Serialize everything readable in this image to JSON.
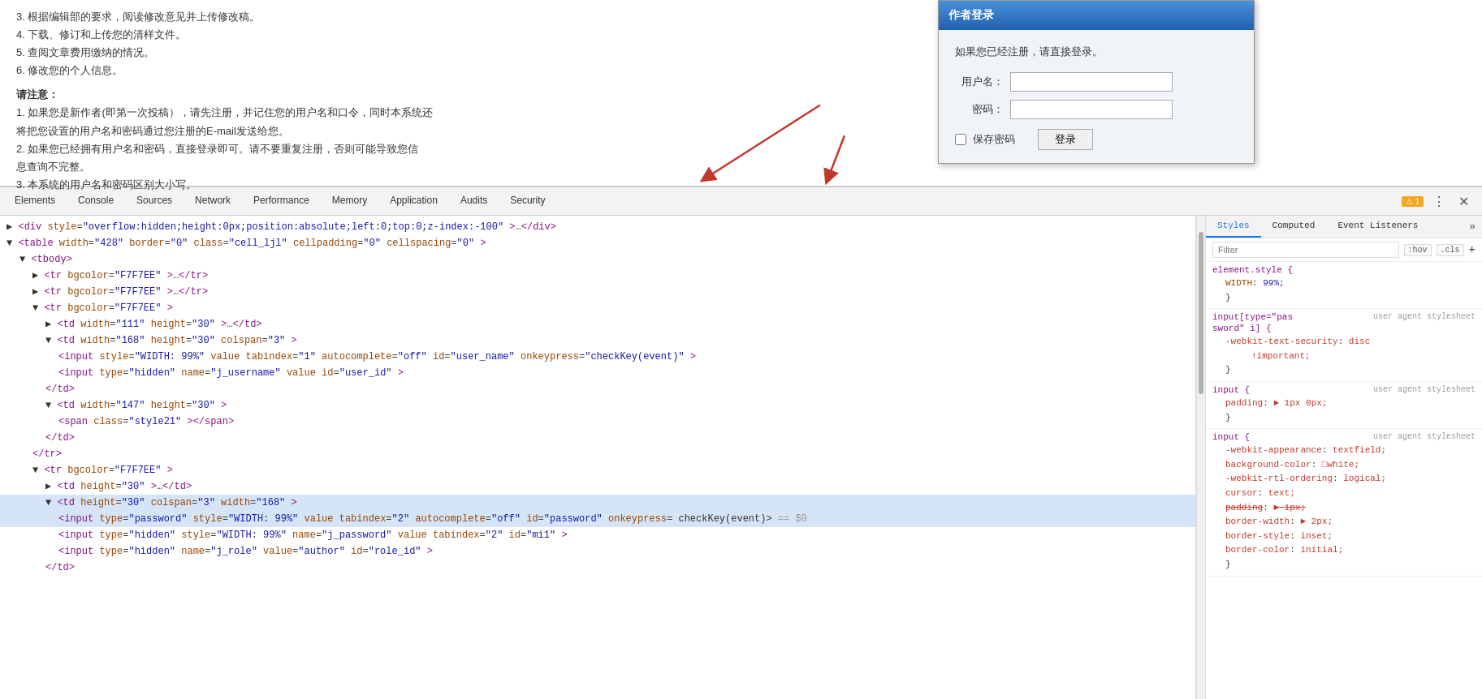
{
  "page": {
    "content_lines": [
      "3. 根据编辑部的要求，阅读修改意见并上传修改稿。",
      "4. 下载、修订和上传您的清样文件。",
      "5. 查阅文章费用缴纳的情况。",
      "6. 修改您的个人信息。",
      "",
      "请注意：",
      "1. 如果您是新作者(即第一次投稿），请先注册，并记住您的用户名和口令，同时本系统还将把您设置的用户名和密码通过您注册的E-mail发送给您。",
      "2. 如果您已经拥有用户名和密码，直接登录即可。请不要重复注册，否则可能导致您信息查询不完整。",
      "3. 本系统的用户名和密码区别大小写。"
    ]
  },
  "dialog": {
    "title": "作者登录",
    "hint": "如果您已经注册，请直接登录。",
    "username_label": "用户名：",
    "password_label": "密码：",
    "save_password_label": "保存密码",
    "login_button": "登录"
  },
  "devtools": {
    "tabs": [
      {
        "id": "elements",
        "label": "Elements",
        "active": false
      },
      {
        "id": "console",
        "label": "Console",
        "active": false
      },
      {
        "id": "sources",
        "label": "Sources",
        "active": false
      },
      {
        "id": "network",
        "label": "Network",
        "active": false
      },
      {
        "id": "performance",
        "label": "Performance",
        "active": false
      },
      {
        "id": "memory",
        "label": "Memory",
        "active": false
      },
      {
        "id": "application",
        "label": "Application",
        "active": false
      },
      {
        "id": "audits",
        "label": "Audits",
        "active": false
      },
      {
        "id": "security",
        "label": "Security",
        "active": false
      }
    ],
    "warning_count": "1",
    "styles_panel": {
      "tabs": [
        "Styles",
        "Computed",
        "Event Listeners"
      ],
      "filter_placeholder": "Filter",
      "filter_pseudo": ":hov",
      "filter_class": ".cls",
      "rules": [
        {
          "selector": "element.style {",
          "source": "",
          "properties": [
            {
              "name": "WIDTH",
              "colon": ":",
              "value": "99%;",
              "strikethrough": false
            }
          ]
        },
        {
          "selector": "input[type=\"pas user agent stylesheet",
          "selector2": "sword\" i] {",
          "source": "",
          "properties": [
            {
              "name": "-webkit-text-security",
              "colon": ":",
              "value": "disc",
              "extra": "!important;",
              "strikethrough": false,
              "red": true
            }
          ]
        },
        {
          "selector": "input {",
          "source": "user agent stylesheet",
          "properties": [
            {
              "name": "padding",
              "colon": ":",
              "value": "► 1px 0px;",
              "strikethrough": false,
              "red": true
            }
          ]
        },
        {
          "selector": "input {",
          "source": "user agent stylesheet",
          "properties": [
            {
              "name": "-webkit-appearance",
              "colon": ":",
              "value": "textfield;",
              "red": true
            },
            {
              "name": "background-color",
              "colon": ":",
              "value": "□white;",
              "red": true
            },
            {
              "name": "-webkit-rtl-ordering",
              "colon": ":",
              "value": "logical;",
              "red": true
            },
            {
              "name": "cursor",
              "colon": ":",
              "value": "text;",
              "red": true
            },
            {
              "name": "padding",
              "colon": ":",
              "value": "► 1px;",
              "strikethrough": true,
              "red": true
            },
            {
              "name": "border-width",
              "colon": ":",
              "value": "► 2px;",
              "red": true
            },
            {
              "name": "border-style",
              "colon": ":",
              "value": "inset;",
              "red": true
            },
            {
              "name": "border-color",
              "colon": ":",
              "value": "initial;",
              "red": true
            }
          ]
        }
      ]
    }
  },
  "dom": {
    "lines": [
      {
        "indent": 0,
        "toggle": "▶",
        "html": "&lt;div style=\"overflow:hidden;height:0px;position:absolute;left:0;top:0;z-index:-100\"&gt;…&lt;/div&gt;",
        "id": "l1"
      },
      {
        "indent": 0,
        "toggle": "▼",
        "html": "&lt;table width=\"428\" border=\"0\" class=\"cell_ljl\" cellpadding=\"0\" cellspacing=\"0\"&gt;",
        "id": "l2"
      },
      {
        "indent": 1,
        "toggle": "▼",
        "html": "&lt;tbody&gt;",
        "id": "l3"
      },
      {
        "indent": 2,
        "toggle": "▶",
        "html": "&lt;tr bgcolor=\"F7F7EE\"&gt;…&lt;/tr&gt;",
        "id": "l4"
      },
      {
        "indent": 2,
        "toggle": "▶",
        "html": "&lt;tr bgcolor=\"F7F7EE\"&gt;…&lt;/tr&gt;",
        "id": "l5"
      },
      {
        "indent": 2,
        "toggle": "▼",
        "html": "&lt;tr bgcolor=\"F7F7EE\"&gt;",
        "id": "l6"
      },
      {
        "indent": 3,
        "toggle": "▶",
        "html": "&lt;td width=\"111\" height=\"30\"&gt;…&lt;/td&gt;",
        "id": "l7"
      },
      {
        "indent": 3,
        "toggle": "▼",
        "html": "&lt;td width=\"168\" height=\"30\" colspan=\"3\"&gt;",
        "id": "l8"
      },
      {
        "indent": 4,
        "toggle": "",
        "html": "&lt;input style=\"WIDTH: 99%\" value tabindex=\"1\" autocomplete=\"off\" id=\"user_name\" onkeypress=\"checkKey(event)\"&gt;",
        "id": "l9"
      },
      {
        "indent": 4,
        "toggle": "",
        "html": "&lt;input type=\"hidden\" name=\"j_username\" value id=\"user_id\"&gt;",
        "id": "l10"
      },
      {
        "indent": 3,
        "toggle": "",
        "html": "&lt;/td&gt;",
        "id": "l11"
      },
      {
        "indent": 3,
        "toggle": "▼",
        "html": "&lt;td width=\"147\" height=\"30\"&gt;",
        "id": "l12"
      },
      {
        "indent": 4,
        "toggle": "",
        "html": "&lt;span class=\"style21\"&gt;&lt;/span&gt;",
        "id": "l13"
      },
      {
        "indent": 3,
        "toggle": "",
        "html": "&lt;/td&gt;",
        "id": "l14"
      },
      {
        "indent": 2,
        "toggle": "",
        "html": "&lt;/tr&gt;",
        "id": "l15"
      },
      {
        "indent": 2,
        "toggle": "▼",
        "html": "&lt;tr bgcolor=\"F7F7EE\"&gt;",
        "id": "l16"
      },
      {
        "indent": 3,
        "toggle": "▶",
        "html": "&lt;td height=\"30\"&gt;…&lt;/td&gt;",
        "id": "l17"
      },
      {
        "indent": 3,
        "toggle": "▼",
        "html": "&lt;td height=\"30\" colspan=\"3\" width=\"168\"&gt;",
        "id": "l18",
        "selected": true
      },
      {
        "indent": 4,
        "toggle": "",
        "html": "&lt;input type=\"password\" style=\"WIDTH: 99%\" value tabindex=\"2\" autocomplete=\"off\" id=\"password\" onkeypress=",
        "continuation": "checkKey(event)&gt; == $0",
        "id": "l19",
        "selected": true
      },
      {
        "indent": 4,
        "toggle": "",
        "html": "&lt;input type=\"hidden\" style=\"WIDTH: 99%\" name=\"j_password\" value tabindex=\"2\" id=\"mi1\"&gt;",
        "id": "l20"
      },
      {
        "indent": 4,
        "toggle": "",
        "html": "&lt;input type=\"hidden\" name=\"j_role\" value=\"author\" id=\"role_id\"&gt;",
        "id": "l21"
      },
      {
        "indent": 3,
        "toggle": "",
        "html": "&lt;/td&gt;",
        "id": "l22"
      }
    ]
  }
}
